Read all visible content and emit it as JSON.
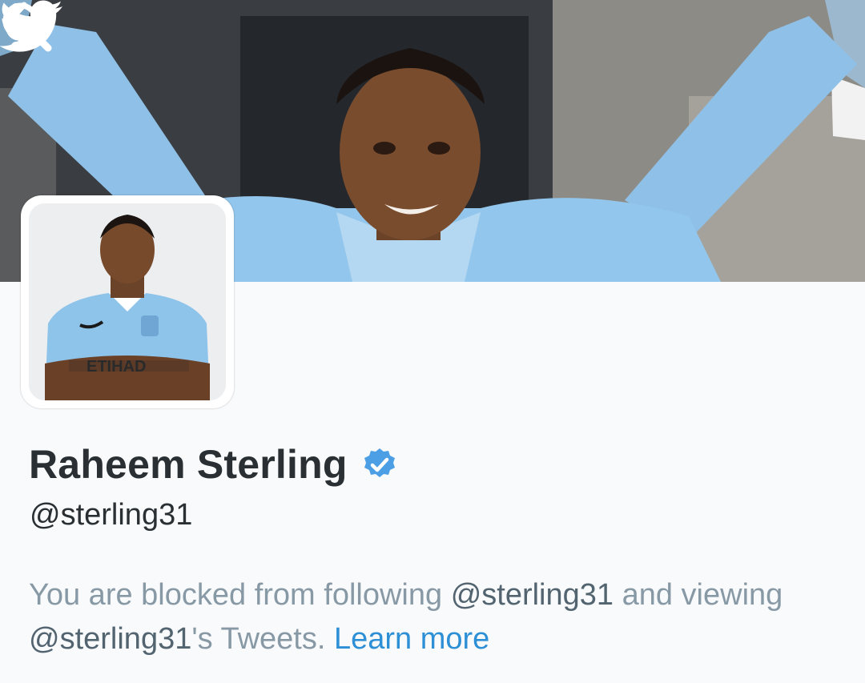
{
  "header": {
    "back_icon": "chevron-left-icon",
    "logo_icon": "twitter-bird-icon",
    "search_icon": "search-icon",
    "menu_icon": "more-vertical-icon"
  },
  "profile": {
    "display_name": "Raheem Sterling",
    "verified": true,
    "handle": "@sterling31",
    "avatar_shirt_text": "ETIHAD"
  },
  "blocked_notice": {
    "text_1": "You are blocked from following ",
    "mention_1": "@sterling31",
    "text_2": " and viewing ",
    "mention_2": "@sterling31",
    "text_3": "'s Tweets. ",
    "learn_more": "Learn more"
  },
  "colors": {
    "name_text": "#292f33",
    "muted_text": "#8899a6",
    "link_blue": "#2d8fd5",
    "verified_blue": "#4d9fe5",
    "kit_sky_blue": "#8ec3ea"
  }
}
